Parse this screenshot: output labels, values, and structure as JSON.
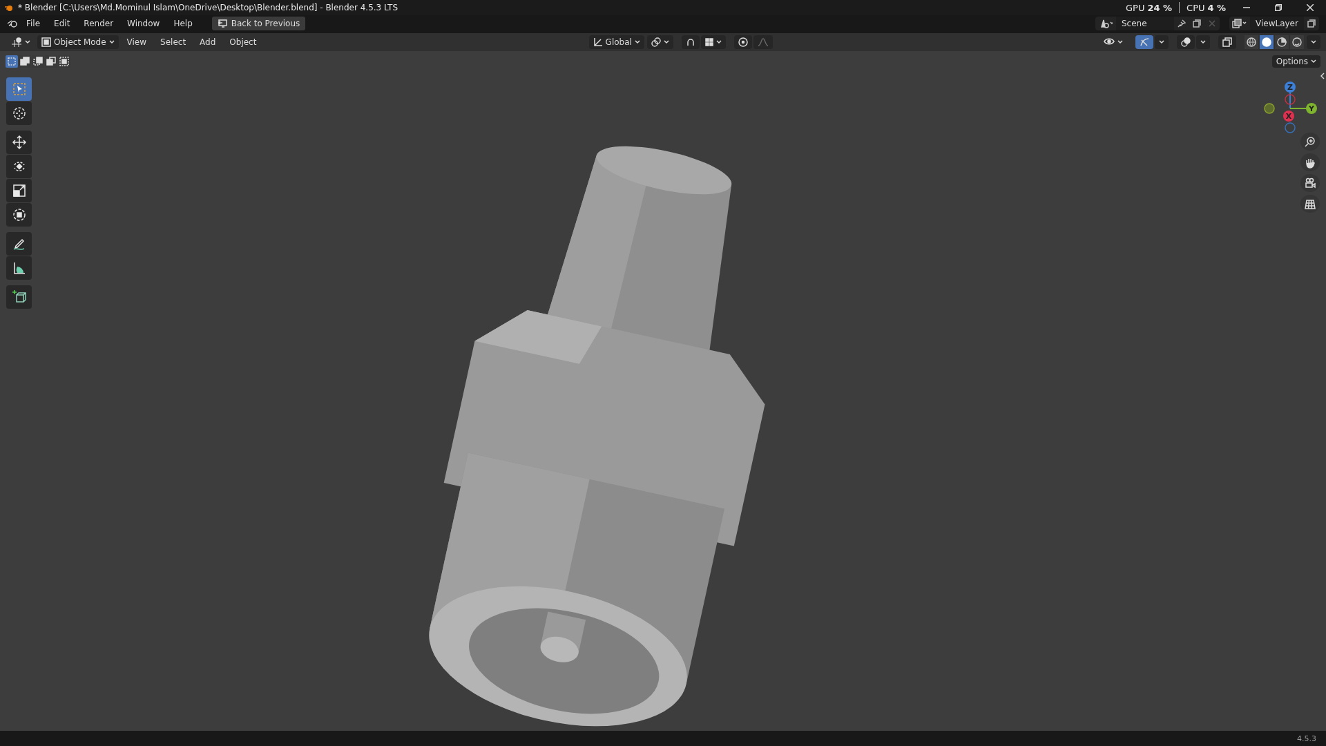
{
  "window": {
    "title": "* Blender [C:\\Users\\Md.Mominul Islam\\OneDrive\\Desktop\\Blender.blend] - Blender 4.5.3 LTS"
  },
  "menu_bar": {
    "items": [
      "File",
      "Edit",
      "Render",
      "Window",
      "Help"
    ],
    "back_button": "Back to Previous",
    "scene": "Scene",
    "view_layer": "ViewLayer"
  },
  "performance_overlay": {
    "gpu_label": "GPU",
    "gpu_value": "24 %",
    "cpu_label": "CPU",
    "cpu_value": "4 %"
  },
  "viewport_header": {
    "mode": "Object Mode",
    "menus": [
      "View",
      "Select",
      "Add",
      "Object"
    ],
    "orientation": "Global",
    "gizmos_on": true,
    "shading": [
      {
        "kind": "wireframe",
        "selected": false
      },
      {
        "kind": "solid",
        "selected": true
      },
      {
        "kind": "material",
        "selected": false
      },
      {
        "kind": "rendered",
        "selected": false
      }
    ]
  },
  "select_modes": [
    {
      "kind": "set",
      "selected": true
    },
    {
      "kind": "extend",
      "selected": false
    },
    {
      "kind": "subtract",
      "selected": false
    },
    {
      "kind": "difference",
      "selected": false
    },
    {
      "kind": "intersect",
      "selected": false
    }
  ],
  "options_button": "Options",
  "toolbar": {
    "groups": [
      {
        "tools": [
          {
            "kind": "select-box",
            "selected": true
          },
          {
            "kind": "cursor",
            "selected": false
          }
        ]
      },
      {
        "tools": [
          {
            "kind": "move",
            "selected": false
          },
          {
            "kind": "rotate",
            "selected": false
          },
          {
            "kind": "scale",
            "selected": false
          },
          {
            "kind": "transform",
            "selected": false
          }
        ]
      },
      {
        "tools": [
          {
            "kind": "annotate",
            "selected": false
          },
          {
            "kind": "measure",
            "selected": false
          }
        ]
      },
      {
        "tools": [
          {
            "kind": "add-cube",
            "selected": false
          }
        ]
      }
    ]
  },
  "gizmo": {
    "z_label": "Z",
    "y_label": "Y",
    "x_label": "X"
  },
  "navigation": [
    {
      "kind": "zoom"
    },
    {
      "kind": "pan"
    },
    {
      "kind": "camera"
    },
    {
      "kind": "ortho"
    }
  ],
  "status_bar": {
    "version": "4.5.3"
  }
}
